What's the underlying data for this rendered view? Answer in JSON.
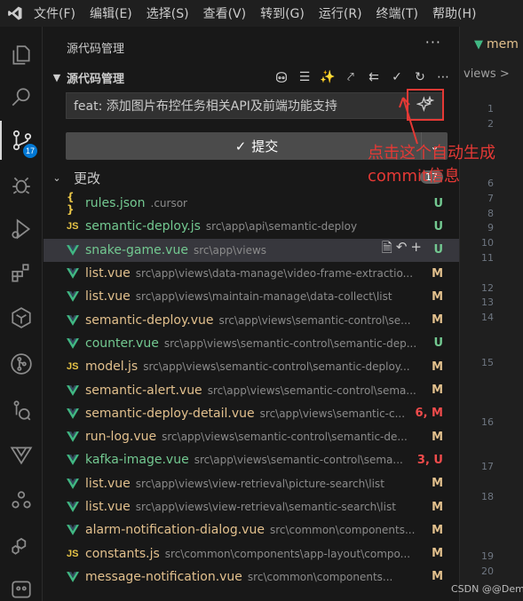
{
  "menubar": {
    "items": [
      "文件(F)",
      "编辑(E)",
      "选择(S)",
      "查看(V)",
      "转到(G)",
      "运行(R)",
      "终端(T)",
      "帮助(H)"
    ]
  },
  "activity": {
    "source_control_badge": "17"
  },
  "sidebar": {
    "title": "源代码管理",
    "more": "···",
    "section_title": "源代码管理",
    "commit_message": "feat: 添加图片布控任务相关API及前端功能支持",
    "commit_button": "提交",
    "changes_label": "更改",
    "changes_count": "17",
    "files": [
      {
        "icon": "json",
        "name": "rules.json",
        "path": ".cursor",
        "status": "U",
        "kind": "untracked"
      },
      {
        "icon": "js",
        "name": "semantic-deploy.js",
        "path": "src\\app\\api\\semantic-deploy",
        "status": "U",
        "kind": "untracked"
      },
      {
        "icon": "vue",
        "name": "snake-game.vue",
        "path": "src\\app\\views",
        "status": "U",
        "kind": "untracked"
      },
      {
        "icon": "vue",
        "name": "list.vue",
        "path": "src\\app\\views\\data-manage\\video-frame-extractio...",
        "status": "M",
        "kind": "modified"
      },
      {
        "icon": "vue",
        "name": "list.vue",
        "path": "src\\app\\views\\maintain-manage\\data-collect\\list",
        "status": "M",
        "kind": "modified"
      },
      {
        "icon": "vue",
        "name": "semantic-deploy.vue",
        "path": "src\\app\\views\\semantic-control\\se...",
        "status": "M",
        "kind": "modified"
      },
      {
        "icon": "vue",
        "name": "counter.vue",
        "path": "src\\app\\views\\semantic-control\\semantic-dep...",
        "status": "U",
        "kind": "untracked"
      },
      {
        "icon": "js",
        "name": "model.js",
        "path": "src\\app\\views\\semantic-control\\semantic-deploy...",
        "status": "M",
        "kind": "modified"
      },
      {
        "icon": "vue",
        "name": "semantic-alert.vue",
        "path": "src\\app\\views\\semantic-control\\sema...",
        "status": "M",
        "kind": "modified"
      },
      {
        "icon": "vue",
        "name": "semantic-deploy-detail.vue",
        "path": "src\\app\\views\\semantic-c...",
        "status": "6, M",
        "kind": "error"
      },
      {
        "icon": "vue",
        "name": "run-log.vue",
        "path": "src\\app\\views\\semantic-control\\semantic-de...",
        "status": "M",
        "kind": "modified"
      },
      {
        "icon": "vue",
        "name": "kafka-image.vue",
        "path": "src\\app\\views\\semantic-control\\sema...",
        "status": "3, U",
        "kind": "error"
      },
      {
        "icon": "vue",
        "name": "list.vue",
        "path": "src\\app\\views\\view-retrieval\\picture-search\\list",
        "status": "M",
        "kind": "modified"
      },
      {
        "icon": "vue",
        "name": "list.vue",
        "path": "src\\app\\views\\view-retrieval\\semantic-search\\list",
        "status": "M",
        "kind": "modified"
      },
      {
        "icon": "vue",
        "name": "alarm-notification-dialog.vue",
        "path": "src\\common\\components...",
        "status": "M",
        "kind": "modified"
      },
      {
        "icon": "js",
        "name": "constants.js",
        "path": "src\\common\\components\\app-layout\\compo...",
        "status": "M",
        "kind": "modified"
      },
      {
        "icon": "vue",
        "name": "message-notification.vue",
        "path": "src\\common\\components...",
        "status": "M",
        "kind": "modified"
      }
    ]
  },
  "editor": {
    "tab_name": "mem",
    "breadcrumb": "views >",
    "line_numbers": [
      {
        "n": "1",
        "row": 0
      },
      {
        "n": "2",
        "row": 1
      },
      {
        "n": "6",
        "row": 5
      },
      {
        "n": "7",
        "row": 6
      },
      {
        "n": "8",
        "row": 7
      },
      {
        "n": "9",
        "row": 8
      },
      {
        "n": "10",
        "row": 9
      },
      {
        "n": "11",
        "row": 10
      },
      {
        "n": "12",
        "row": 12
      },
      {
        "n": "13",
        "row": 13
      },
      {
        "n": "14",
        "row": 14
      },
      {
        "n": "15",
        "row": 17
      },
      {
        "n": "16",
        "row": 21
      },
      {
        "n": "17",
        "row": 24
      },
      {
        "n": "18",
        "row": 26
      },
      {
        "n": "19",
        "row": 30
      },
      {
        "n": "20",
        "row": 31
      }
    ]
  },
  "annotation": {
    "text": "点击这个自动生成commit信息"
  },
  "watermark": "CSDN @@Demi",
  "colors": {
    "accent": "#0078d4",
    "modified": "#e2c08d",
    "untracked": "#73c991",
    "error": "#f14c4c",
    "annotation": "#e53935",
    "vue_icon": "#41b883"
  }
}
